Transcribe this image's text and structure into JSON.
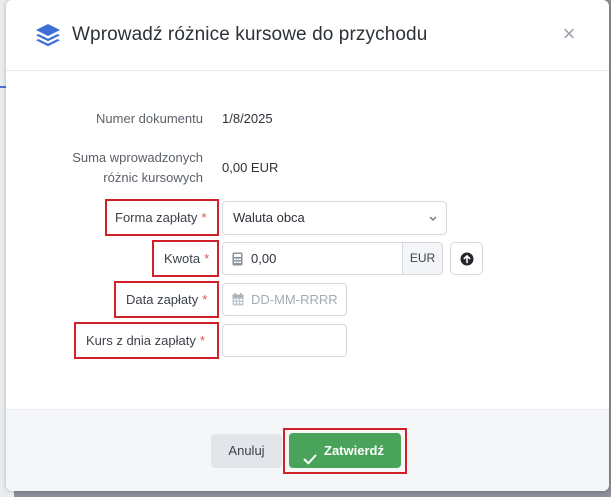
{
  "dialog": {
    "title": "Wprowadź różnice kursowe do przychodu",
    "close_symbol": "×"
  },
  "info": {
    "document_number_label": "Numer dokumentu",
    "document_number_value": "1/8/2025",
    "sum_label_line1": "Suma wprowadzonych",
    "sum_label_line2": "różnic kursowych",
    "sum_value": "0,00 EUR"
  },
  "form": {
    "payment_form": {
      "label": "Forma zapłaty",
      "required": "*",
      "value": "Waluta obca"
    },
    "amount": {
      "label": "Kwota",
      "required": "*",
      "value": "0,00",
      "currency": "EUR"
    },
    "payment_date": {
      "label": "Data zapłaty",
      "required": "*",
      "placeholder": "DD-MM-RRRR"
    },
    "rate": {
      "label": "Kurs z dnia zapłaty",
      "required": "*",
      "value": ""
    }
  },
  "footer": {
    "cancel_label": "Anuluj",
    "confirm_label": "Zatwierdź"
  },
  "icons": {
    "header": "layers-icon",
    "close": "close-icon",
    "select": "chevron-down-icon",
    "amount": "calculator-icon",
    "date": "calendar-icon",
    "upload": "arrow-up-circle-icon",
    "confirm": "check-icon"
  },
  "colors": {
    "accent": "#3d6fd6",
    "confirm": "#4aa35a",
    "highlight": "#d1202a",
    "required": "#d9534f"
  }
}
